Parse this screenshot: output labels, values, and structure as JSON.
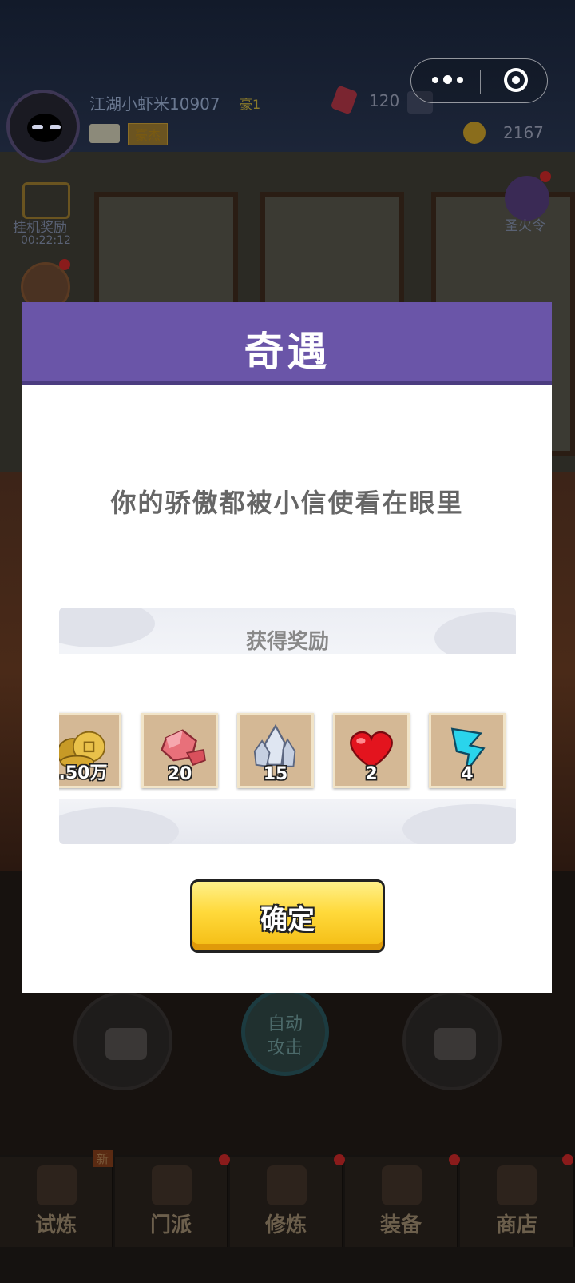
{
  "hud": {
    "player_name": "江湖小虾米10907",
    "rank": "豪1",
    "title_badge": "豪杰",
    "gems": "120",
    "coins": "2167",
    "idle_reward_label": "挂机奖励",
    "idle_timer": "00:22:12",
    "fire_token_label": "圣火令"
  },
  "capsule": {
    "menu_icon": "more-dots-icon",
    "close_icon": "close-circle-icon"
  },
  "modal": {
    "title": "奇遇",
    "message": "你的骄傲都被小信使看在眼里",
    "reward_title": "获得奖励",
    "rewards": [
      {
        "icon": "copper-coins-icon",
        "qty": ".50万"
      },
      {
        "icon": "red-gem-icon",
        "qty": "20"
      },
      {
        "icon": "crystal-icon",
        "qty": "15"
      },
      {
        "icon": "heart-icon",
        "qty": "2"
      },
      {
        "icon": "lightning-icon",
        "qty": "4"
      }
    ],
    "confirm_label": "确定"
  },
  "controls": {
    "auto_attack_line1": "自动",
    "auto_attack_line2": "攻击"
  },
  "tabs": [
    {
      "label": "试炼",
      "badge": "新"
    },
    {
      "label": "门派"
    },
    {
      "label": "修炼"
    },
    {
      "label": "装备"
    },
    {
      "label": "商店"
    }
  ],
  "colors": {
    "header": "#6a55a8",
    "button": "#ffd93a"
  }
}
